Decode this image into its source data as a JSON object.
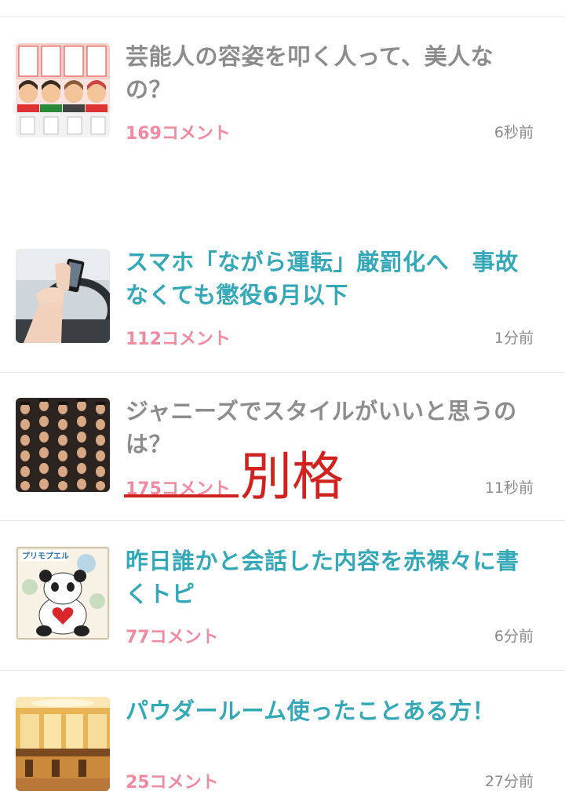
{
  "topics": [
    {
      "title": "芸能人の容姿を叩く人って、美人なの？",
      "comments": "169コメント",
      "time": "6秒前",
      "read": true
    },
    {
      "title": "スマホ「ながら運転」厳罰化へ　事故なくても懲役6月以下",
      "comments": "112コメント",
      "time": "1分前",
      "read": false
    },
    {
      "title": "ジャニーズでスタイルがいいと思うのは？",
      "comments": "175コメント",
      "time": "11秒前",
      "read": true
    },
    {
      "title": "昨日誰かと会話した内容を赤裸々に書くトピ",
      "comments": "77コメント",
      "time": "6分前",
      "read": false
    },
    {
      "title": "パウダールーム使ったことある方！",
      "comments": "25コメント",
      "time": "27分前",
      "read": false
    }
  ],
  "thumbs": {
    "topic4_brand": "プリモプエル"
  },
  "annotation": {
    "text": "別格",
    "color": "#d0231f"
  },
  "colors": {
    "unread_title": "#35a8b7",
    "read_title": "#8c8c8c",
    "comment_count": "#f08aa0"
  }
}
